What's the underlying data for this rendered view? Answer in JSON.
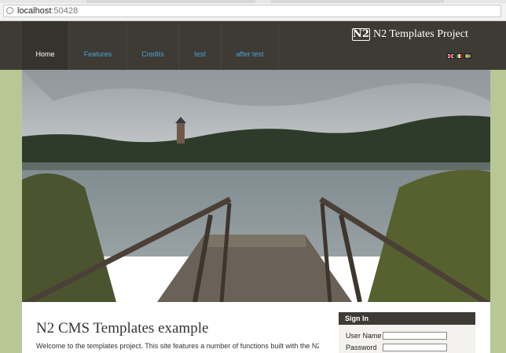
{
  "browser": {
    "address_host": "localhost",
    "address_port": ":50428"
  },
  "site": {
    "title": "N2 Templates Project",
    "logo_text": "N2"
  },
  "nav": {
    "items": [
      {
        "label": "Home"
      },
      {
        "label": "Features"
      },
      {
        "label": "Credits"
      },
      {
        "label": "test"
      },
      {
        "label": "after test"
      }
    ]
  },
  "languages": [
    {
      "code": "en",
      "icon": "uk-flag-icon"
    },
    {
      "code": "it",
      "icon": "italy-flag-icon"
    },
    {
      "code": "sv",
      "icon": "sweden-flag-icon"
    }
  ],
  "main": {
    "heading": "N2 CMS Templates example",
    "intro": "Welcome to the templates project. This site features a number of functions built with the N2"
  },
  "signin": {
    "title": "Sign In",
    "user_label": "User Name",
    "password_label": "Password"
  },
  "colors": {
    "header_bg": "#3e3a34",
    "nav_link": "#4aa3d6",
    "sidebar_green": "#b8c795"
  }
}
